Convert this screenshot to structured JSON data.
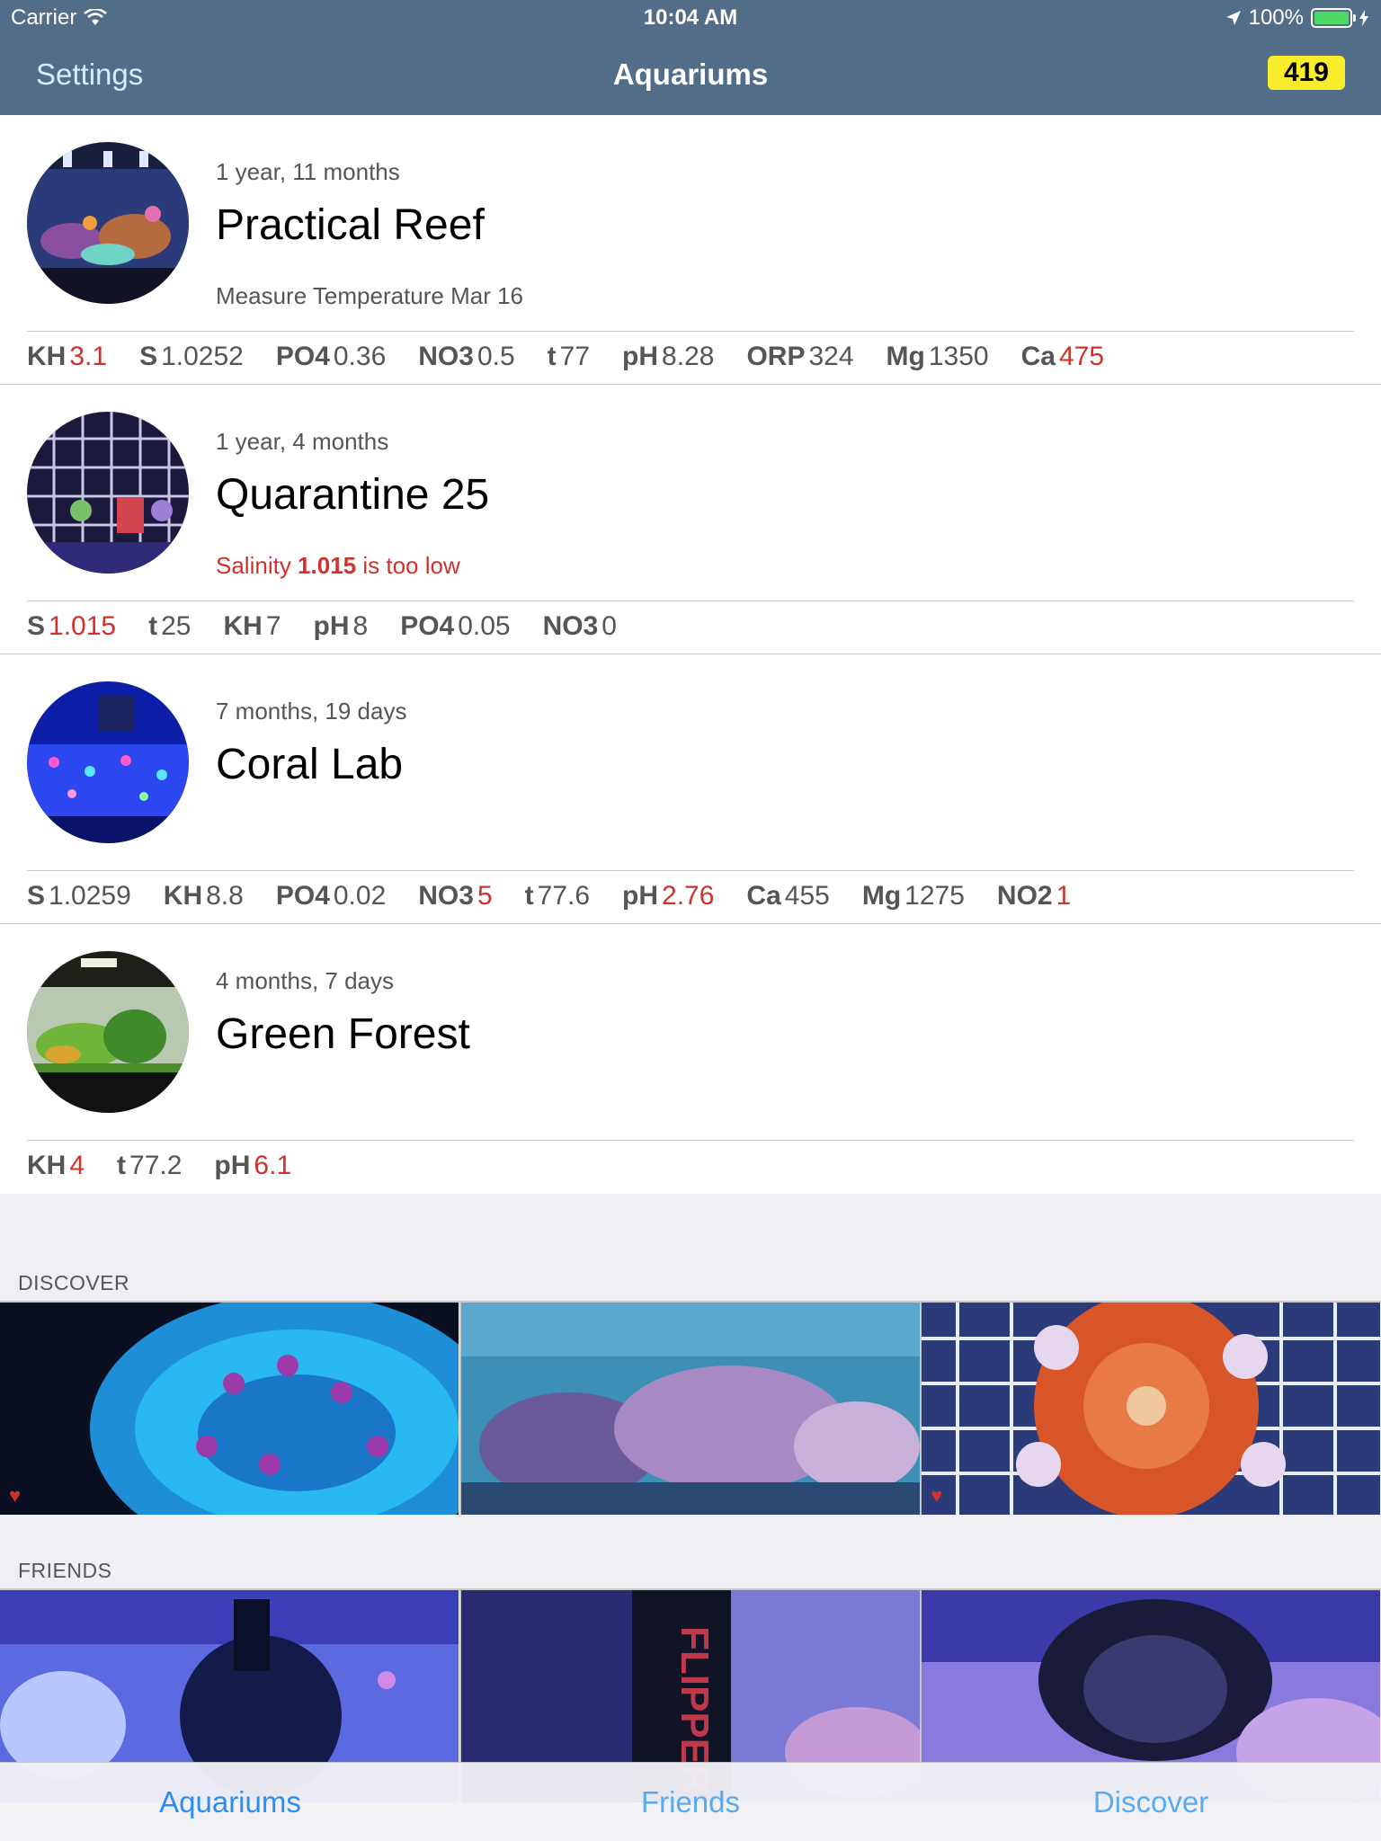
{
  "status": {
    "carrier": "Carrier",
    "time": "10:04 AM",
    "battery": "100%"
  },
  "nav": {
    "left": "Settings",
    "title": "Aquariums",
    "badge": "419"
  },
  "aquariums": [
    {
      "age": "1 year, 11 months",
      "name": "Practical Reef",
      "note": "Measure Temperature Mar 16",
      "note_type": "normal",
      "params": [
        {
          "k": "KH",
          "v": "3.1",
          "bad": true
        },
        {
          "k": "S",
          "v": "1.0252",
          "bad": false
        },
        {
          "k": "PO4",
          "v": "0.36",
          "bad": false
        },
        {
          "k": "NO3",
          "v": "0.5",
          "bad": false
        },
        {
          "k": "t",
          "v": "77",
          "bad": false
        },
        {
          "k": "pH",
          "v": "8.28",
          "bad": false
        },
        {
          "k": "ORP",
          "v": "324",
          "bad": false
        },
        {
          "k": "Mg",
          "v": "1350",
          "bad": false
        },
        {
          "k": "Ca",
          "v": "475",
          "bad": true
        }
      ]
    },
    {
      "age": "1 year, 4 months",
      "name": "Quarantine 25",
      "note_prefix": "Salinity ",
      "note_bold": "1.015",
      "note_suffix": " is too low",
      "note_type": "alert",
      "params": [
        {
          "k": "S",
          "v": "1.015",
          "bad": true
        },
        {
          "k": "t",
          "v": "25",
          "bad": false
        },
        {
          "k": "KH",
          "v": "7",
          "bad": false
        },
        {
          "k": "pH",
          "v": "8",
          "bad": false
        },
        {
          "k": "PO4",
          "v": "0.05",
          "bad": false
        },
        {
          "k": "NO3",
          "v": "0",
          "bad": false
        }
      ]
    },
    {
      "age": "7 months, 19 days",
      "name": "Coral Lab",
      "note": "",
      "params": [
        {
          "k": "S",
          "v": "1.0259",
          "bad": false
        },
        {
          "k": "KH",
          "v": "8.8",
          "bad": false
        },
        {
          "k": "PO4",
          "v": "0.02",
          "bad": false
        },
        {
          "k": "NO3",
          "v": "5",
          "bad": true
        },
        {
          "k": "t",
          "v": "77.6",
          "bad": false
        },
        {
          "k": "pH",
          "v": "2.76",
          "bad": true
        },
        {
          "k": "Ca",
          "v": "455",
          "bad": false
        },
        {
          "k": "Mg",
          "v": "1275",
          "bad": false
        },
        {
          "k": "NO2",
          "v": "1",
          "bad": true
        }
      ]
    },
    {
      "age": "4 months, 7 days",
      "name": "Green Forest",
      "note": "",
      "params": [
        {
          "k": "KH",
          "v": "4",
          "bad": true
        },
        {
          "k": "t",
          "v": "77.2",
          "bad": false
        },
        {
          "k": "pH",
          "v": "6.1",
          "bad": true
        }
      ]
    }
  ],
  "sections": {
    "discover": "DISCOVER",
    "friends": "FRIENDS"
  },
  "tabs": [
    "Aquariums",
    "Friends",
    "Discover"
  ],
  "colors": {
    "nav": "#526d88",
    "alert": "#d0312a",
    "badge": "#f8ec2c",
    "tab": "#2e8ef0"
  }
}
